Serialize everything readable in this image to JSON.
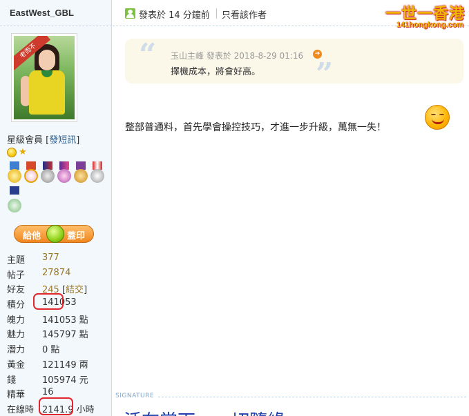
{
  "sidebar": {
    "username": "EastWest_GBL",
    "avatar_ribbon": "老而不",
    "member_level": "星級會員",
    "send_sms_label": "發短訊",
    "give_button": {
      "left_label": "給他",
      "right_label": "蓋印"
    },
    "stats": [
      {
        "label": "主題",
        "value": "377"
      },
      {
        "label": "帖子",
        "value": "27874"
      },
      {
        "label": "好友",
        "value": "245",
        "extra": "結交"
      },
      {
        "label": "積分",
        "value": "141053"
      },
      {
        "label": "魄力",
        "value": "141053 點"
      },
      {
        "label": "魅力",
        "value": "145797 點"
      },
      {
        "label": "潛力",
        "value": "0 點"
      },
      {
        "label": "黃金",
        "value": "121149 兩"
      },
      {
        "label": "錢",
        "value": "105974 元"
      },
      {
        "label": "精華",
        "value": "16"
      },
      {
        "label": "在線時",
        "value": "2141.9",
        "unit": "小時"
      }
    ],
    "highlight_color": "#e0262c"
  },
  "post": {
    "header": {
      "posted_at": "發表於 14 分鐘前",
      "only_author": "只看該作者"
    },
    "site_logo": {
      "zh": "一世一香港",
      "en": "141hongkong.com"
    },
    "quote": {
      "meta": "玉山主峰  發表於 2018-8-29 01:16",
      "text": "擇機成本，將會好高。"
    },
    "body": "整部普通料，首先學會操控技巧，才進一步升級，萬無一失！",
    "signature_label": "SIGNATURE",
    "signature_text": "活在當下……切隨緣"
  },
  "colors": {
    "sidebar_bg": "#f3f8fc",
    "stat_value": "#9a7720",
    "link_blue": "#2b5d8c",
    "quote_bg": "#fbf8ea",
    "signature_blue": "#1e3fae"
  }
}
